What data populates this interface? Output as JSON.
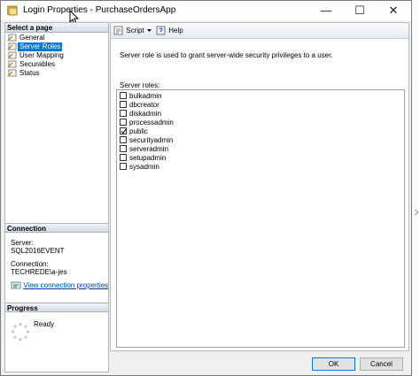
{
  "window": {
    "title": "Login Properties - PurchaseOrdersApp",
    "minimize_glyph": "—",
    "maximize_glyph": "☐",
    "close_glyph": "✕"
  },
  "left_pane": {
    "select_page_header": "Select a page",
    "pages": [
      {
        "label": "General",
        "selected": false
      },
      {
        "label": "Server Roles",
        "selected": true
      },
      {
        "label": "User Mapping",
        "selected": false
      },
      {
        "label": "Securables",
        "selected": false
      },
      {
        "label": "Status",
        "selected": false
      }
    ],
    "connection_header": "Connection",
    "server_label": "Server:",
    "server_value": "SQL2016EVENT",
    "connection_label": "Connection:",
    "connection_value": "TECHREDE\\a-jes",
    "view_connection_link": "View connection properties",
    "progress_header": "Progress",
    "progress_status": "Ready"
  },
  "toolbar": {
    "script_label": "Script",
    "help_label": "Help"
  },
  "main": {
    "description": "Server role is used to grant server-wide security privileges to a user.",
    "roles_label": "Server roles:",
    "roles": [
      {
        "name": "bulkadmin",
        "checked": false
      },
      {
        "name": "dbcreator",
        "checked": false
      },
      {
        "name": "diskadmin",
        "checked": false
      },
      {
        "name": "processadmin",
        "checked": false
      },
      {
        "name": "public",
        "checked": true
      },
      {
        "name": "securityadmin",
        "checked": false
      },
      {
        "name": "serveradmin",
        "checked": false
      },
      {
        "name": "setupadmin",
        "checked": false
      },
      {
        "name": "sysadmin",
        "checked": false
      }
    ]
  },
  "buttons": {
    "ok": "OK",
    "cancel": "Cancel"
  },
  "colors": {
    "selection": "#0078d7",
    "link": "#0044aa"
  }
}
